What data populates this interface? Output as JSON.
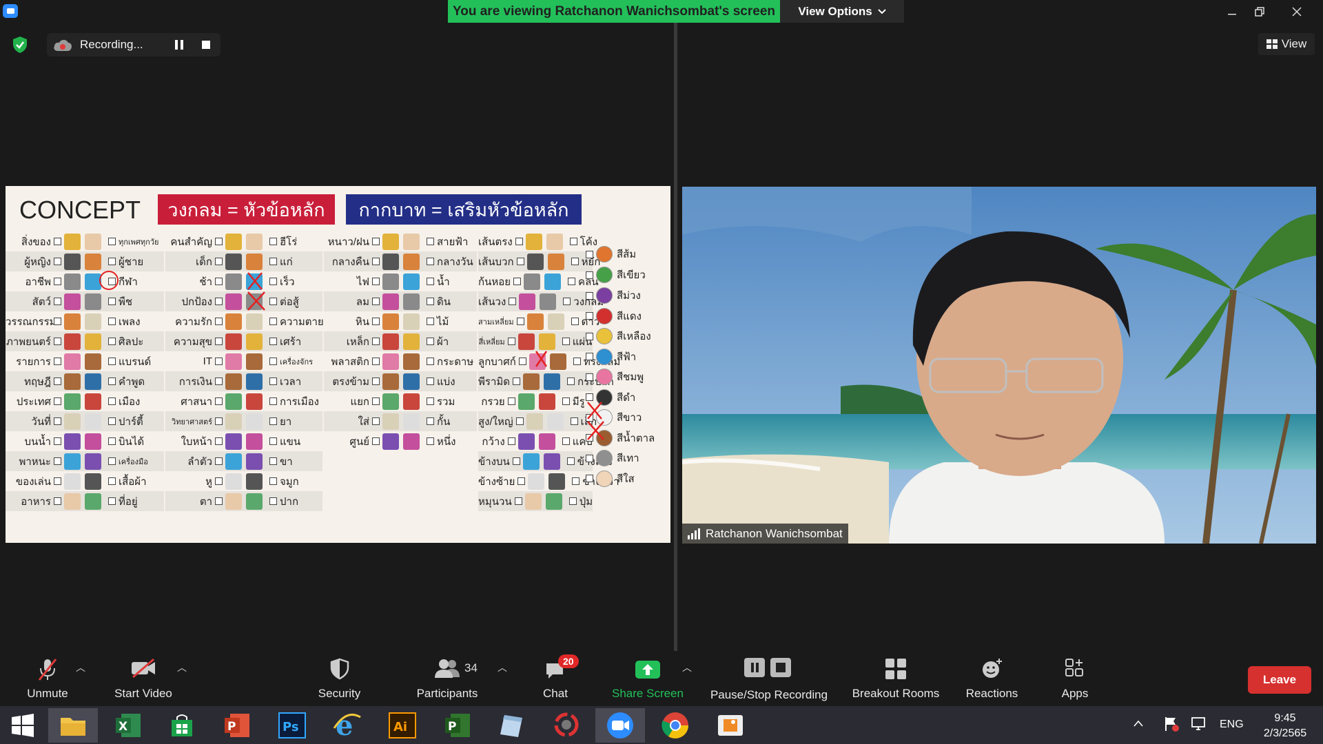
{
  "titlebar": {
    "banner": "You are viewing Ratchanon Wanichsombat's screen",
    "view_options": "View Options"
  },
  "recording": {
    "label": "Recording..."
  },
  "view_button": {
    "label": "View"
  },
  "shared_screen": {
    "concept_title": "CONCEPT",
    "red_box": "วงกลม = หัวข้อหลัก",
    "blue_box": "กากบาท = เสริมหัวข้อหลัก",
    "col1": [
      {
        "l": "สิ่งของ",
        "r": "ทุกเพศทุกวัย"
      },
      {
        "l": "ผู้หญิง",
        "r": "ผู้ชาย"
      },
      {
        "l": "อาชีพ",
        "r": "กีฬา"
      },
      {
        "l": "สัตว์",
        "r": "พืช"
      },
      {
        "l": "วรรณกรรม",
        "r": "เพลง"
      },
      {
        "l": "ภาพยนตร์",
        "r": "ศิลปะ"
      },
      {
        "l": "รายการ",
        "r": "แบรนด์"
      },
      {
        "l": "ทฤษฎี",
        "r": "คำพูด"
      },
      {
        "l": "ประเทศ",
        "r": "เมือง"
      },
      {
        "l": "วันที่",
        "r": "ปาร์ตี้"
      },
      {
        "l": "บนน้ำ",
        "r": "บินได้"
      },
      {
        "l": "พาหนะ",
        "r": "เครื่องมือ"
      },
      {
        "l": "ของเล่น",
        "r": "เสื้อผ้า"
      },
      {
        "l": "อาหาร",
        "r": "ที่อยู่"
      }
    ],
    "col2": [
      {
        "l": "คนสำคัญ",
        "r": "ฮีโร่"
      },
      {
        "l": "เด็ก",
        "r": "แก่"
      },
      {
        "l": "ช้า",
        "r": "เร็ว"
      },
      {
        "l": "ปกป้อง",
        "r": "ต่อสู้"
      },
      {
        "l": "ความรัก",
        "r": "ความตาย"
      },
      {
        "l": "ความสุข",
        "r": "เศร้า"
      },
      {
        "l": "IT",
        "r": "เครื่องจักร"
      },
      {
        "l": "การเงิน",
        "r": "เวลา"
      },
      {
        "l": "ศาสนา",
        "r": "การเมือง"
      },
      {
        "l": "วิทยาศาสตร์",
        "r": "ยา"
      },
      {
        "l": "ใบหน้า",
        "r": "แขน"
      },
      {
        "l": "ลำตัว",
        "r": "ขา"
      },
      {
        "l": "หู",
        "r": "จมูก"
      },
      {
        "l": "ตา",
        "r": "ปาก"
      }
    ],
    "col3": [
      {
        "l": "หนาว/ฝน",
        "r": "สายฟ้า"
      },
      {
        "l": "กลางคืน",
        "r": "กลางวัน"
      },
      {
        "l": "ไฟ",
        "r": "น้ำ"
      },
      {
        "l": "ลม",
        "r": "ดิน"
      },
      {
        "l": "หิน",
        "r": "ไม้"
      },
      {
        "l": "เหล็ก",
        "r": "ผ้า"
      },
      {
        "l": "พลาสติก",
        "r": "กระดาษ"
      },
      {
        "l": "ตรงข้าม",
        "r": "แบ่ง"
      },
      {
        "l": "แยก",
        "r": "รวม"
      },
      {
        "l": "ใส่",
        "r": "กั้น"
      },
      {
        "l": "ศูนย์",
        "r": "หนึ่ง"
      }
    ],
    "col4": [
      {
        "l": "เส้นตรง",
        "r": "โค้ง"
      },
      {
        "l": "เส้นบวก",
        "r": "หยัก"
      },
      {
        "l": "ก้นหอย",
        "r": "คลื่น"
      },
      {
        "l": "เส้นวง",
        "r": "วงกลม"
      },
      {
        "l": "สามเหลี่ยม",
        "r": "ดาว"
      },
      {
        "l": "สี่เหลี่ยม",
        "r": "แผ่น"
      },
      {
        "l": "ลูกบาศก์",
        "r": "ทรงกลม"
      },
      {
        "l": "พีรามิด",
        "r": "กระบอก"
      },
      {
        "l": "กรวย",
        "r": "มีรู"
      },
      {
        "l": "สูง/ใหญ่",
        "r": "เล็ก"
      },
      {
        "l": "กว้าง",
        "r": "แคบ"
      },
      {
        "l": "ข้างบน",
        "r": "ข้างล่าง"
      },
      {
        "l": "ข้างซ้าย",
        "r": "ข้างขวา"
      },
      {
        "l": "หมุนวน",
        "r": "ปุ่ม"
      }
    ],
    "col5": [
      "สีส้ม",
      "สีเขียว",
      "สีม่วง",
      "สีแดง",
      "สีเหลือง",
      "สีฟ้า",
      "สีชมพู",
      "สีดำ",
      "สีขาว",
      "สีน้ำตาล",
      "สีเทา",
      "สีใส"
    ]
  },
  "remote": {
    "name": "Ratchanon Wanichsombat"
  },
  "toolbar": {
    "unmute": "Unmute",
    "start_video": "Start Video",
    "security": "Security",
    "participants": "Participants",
    "participants_count": "34",
    "chat": "Chat",
    "chat_badge": "20",
    "share_screen": "Share Screen",
    "pause_stop": "Pause/Stop Recording",
    "breakout": "Breakout Rooms",
    "reactions": "Reactions",
    "apps": "Apps",
    "leave": "Leave"
  },
  "taskbar": {
    "lang": "ENG",
    "time": "9:45",
    "date": "2/3/2565"
  },
  "colors": {
    "banner_green": "#23c05a",
    "share_green": "#23c05a",
    "leave_red": "#d6302f",
    "red_box": "#c91e3a",
    "blue_box": "#232e87"
  }
}
